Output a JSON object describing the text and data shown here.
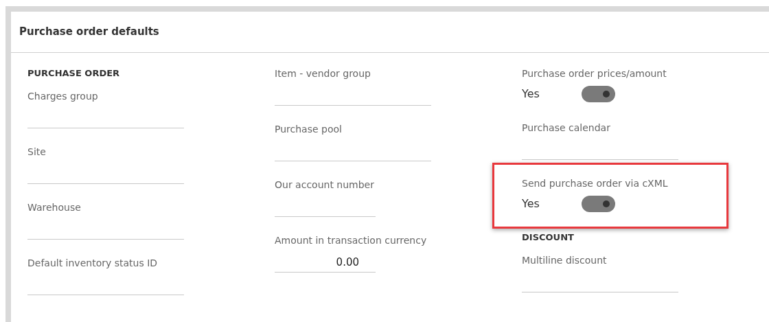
{
  "panel": {
    "title": "Purchase order defaults"
  },
  "columns": [
    {
      "fields": [
        {
          "kind": "heading",
          "label": "PURCHASE ORDER"
        },
        {
          "kind": "lookup",
          "label": "Charges group",
          "highlighted": false
        },
        {
          "kind": "lookup",
          "label": "Site",
          "highlighted": false
        },
        {
          "kind": "lookup",
          "label": "Warehouse",
          "highlighted": false
        },
        {
          "kind": "lookup",
          "label": "Default inventory status ID",
          "highlighted": false
        }
      ]
    },
    {
      "fields": [
        {
          "kind": "lookup",
          "label": "Item - vendor group",
          "highlighted": false
        },
        {
          "kind": "lookup",
          "label": "Purchase pool",
          "highlighted": false
        },
        {
          "kind": "short",
          "label": "Our account number",
          "highlighted": false
        },
        {
          "kind": "amount",
          "label": "Amount in transaction currency",
          "value": "0.00",
          "highlighted": false
        }
      ]
    },
    {
      "fields": [
        {
          "kind": "toggle",
          "label": "Purchase order prices/amount",
          "value": "Yes",
          "on": true,
          "highlighted": false
        },
        {
          "kind": "lookup",
          "label": "Purchase calendar",
          "highlighted": false
        },
        {
          "kind": "toggle",
          "label": "Send purchase order via cXML",
          "value": "Yes",
          "on": true,
          "highlighted": true
        },
        {
          "kind": "heading",
          "label": "DISCOUNT"
        },
        {
          "kind": "lookup",
          "label": "Multiline discount",
          "highlighted": false
        }
      ]
    }
  ]
}
